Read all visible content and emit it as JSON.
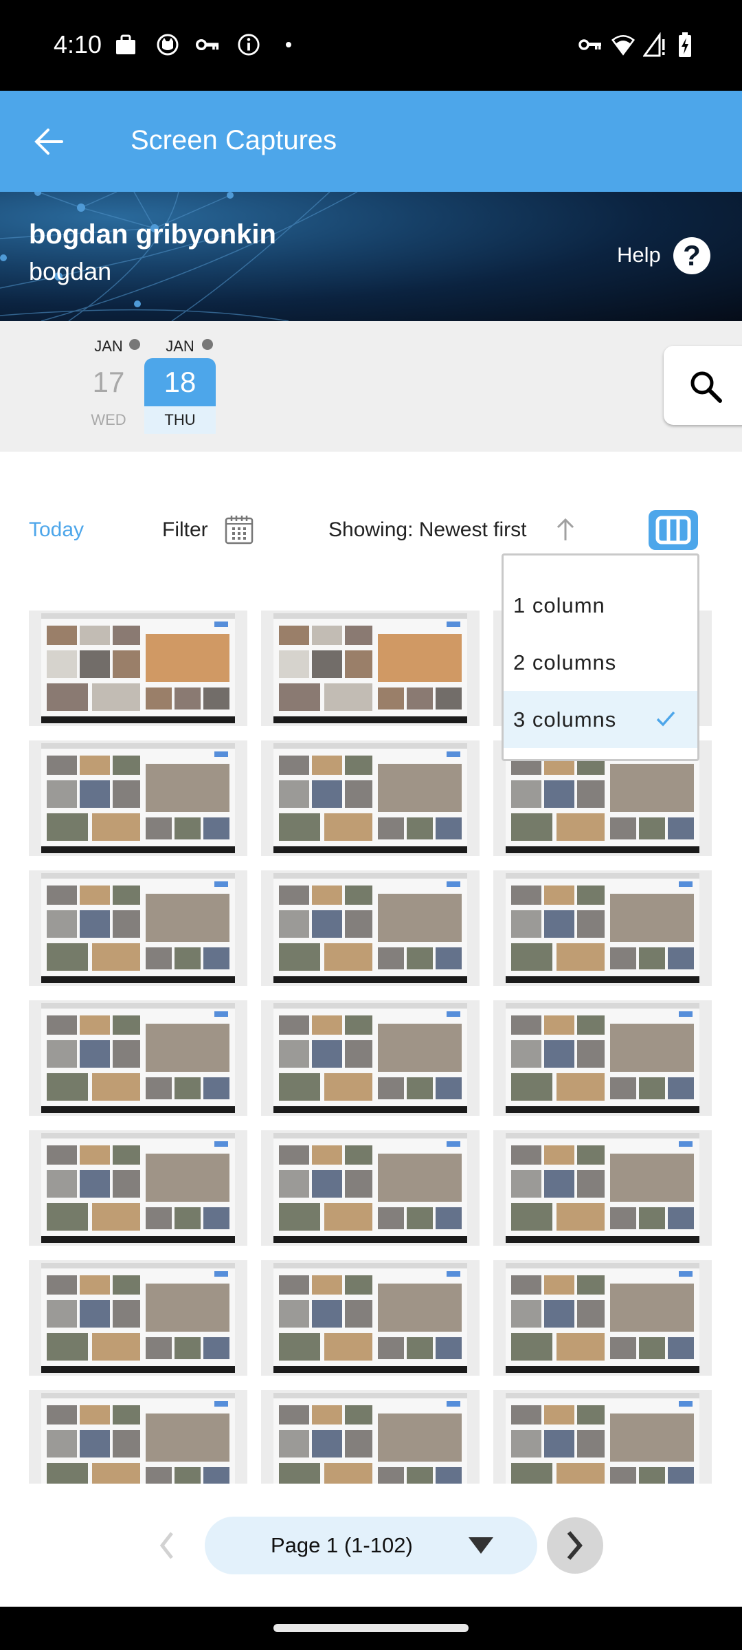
{
  "status_bar": {
    "time": "4:10",
    "left_icons": [
      "briefcase-icon",
      "cat-face-icon",
      "key-icon",
      "info-icon",
      "dot-icon"
    ],
    "right_icons": [
      "vpn-key-icon",
      "wifi-icon",
      "signal-no-data-icon",
      "battery-charging-icon"
    ]
  },
  "app_bar": {
    "back_icon": "arrow-left-icon",
    "title": "Screen Captures"
  },
  "profile": {
    "full_name": "bogdan gribyonkin",
    "username": "bogdan",
    "help_label": "Help",
    "help_icon": "question-circle-icon"
  },
  "dates": [
    {
      "month": "JAN",
      "day": "17",
      "weekday": "WED",
      "has_dot": true,
      "selected": false
    },
    {
      "month": "JAN",
      "day": "18",
      "weekday": "THU",
      "has_dot": true,
      "selected": true
    }
  ],
  "search": {
    "icon": "search-icon"
  },
  "toolbar": {
    "today_label": "Today",
    "filter_label": "Filter",
    "filter_icon": "calendar-icon",
    "sort_label": "Showing: Newest first",
    "sort_icon": "arrow-up-icon",
    "columns_icon": "view-columns-icon"
  },
  "columns_menu": {
    "items": [
      {
        "label": "1 column",
        "selected": false
      },
      {
        "label": "2 columns",
        "selected": false
      },
      {
        "label": "3 columns",
        "selected": true
      }
    ]
  },
  "grid": {
    "columns": 3,
    "thumbnails": [
      {
        "variant": "orange-cat"
      },
      {
        "variant": "orange-cat"
      },
      {
        "variant": "orange-cat"
      },
      {
        "variant": "grey-cats"
      },
      {
        "variant": "grey-cats"
      },
      {
        "variant": "grey-cats"
      },
      {
        "variant": "grey-cats"
      },
      {
        "variant": "grey-cats"
      },
      {
        "variant": "grey-cats"
      },
      {
        "variant": "grey-cats"
      },
      {
        "variant": "grey-cats"
      },
      {
        "variant": "grey-cats"
      },
      {
        "variant": "grey-cats"
      },
      {
        "variant": "grey-cats"
      },
      {
        "variant": "grey-cats"
      },
      {
        "variant": "grey-cats"
      },
      {
        "variant": "grey-cats"
      },
      {
        "variant": "grey-cats"
      },
      {
        "variant": "grey-cats"
      },
      {
        "variant": "grey-cats"
      },
      {
        "variant": "grey-cats"
      }
    ]
  },
  "pagination": {
    "page_label": "Page 1 (1-102)",
    "prev_enabled": false,
    "next_enabled": true
  },
  "colors": {
    "accent": "#4da6ea",
    "selected_bg": "#e6f3fb",
    "date_bar_bg": "#efefef"
  }
}
